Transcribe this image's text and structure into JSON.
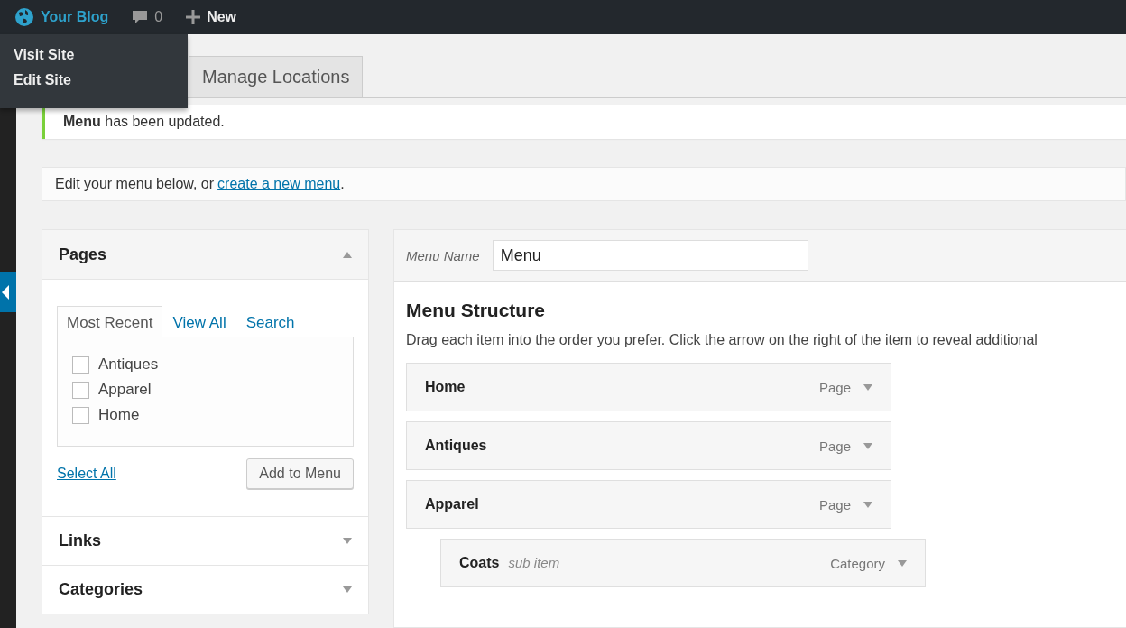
{
  "admin_bar": {
    "site": {
      "label": "Your Blog",
      "hovered": true
    },
    "comments": "0",
    "new": "New"
  },
  "site_menu": {
    "items": [
      "Visit Site",
      "Edit Site"
    ]
  },
  "tabs": [
    {
      "label": "Manage Locations",
      "selected": false
    }
  ],
  "notice": {
    "text": "**Menu** has been updated."
  },
  "edit_bar": {
    "text": "Edit your menu below, or",
    "link": "create a new menu",
    "after": "."
  },
  "sections": [
    {
      "title": "Pages",
      "expanded": true,
      "tabs": [
        {
          "label": "Most Recent",
          "selected": true
        },
        {
          "label": "View All",
          "selected": false
        },
        {
          "label": "Search",
          "selected": false
        }
      ],
      "items": [
        {
          "label": "Antiques",
          "checked": false
        },
        {
          "label": "Apparel",
          "checked": false
        },
        {
          "label": "Home",
          "checked": false
        }
      ],
      "select_all": "Select All",
      "add_button": "Add to Menu"
    },
    {
      "title": "Links",
      "expanded": false
    },
    {
      "title": "Categories",
      "expanded": false
    }
  ],
  "menu": {
    "name_label": "Menu Name",
    "name_value": "Menu",
    "heading": "Menu Structure",
    "description": "Drag each item into the order you prefer. Click the arrow on the right of the item to reveal additional",
    "items": [
      {
        "title": "Home",
        "type": "Page"
      },
      {
        "title": "Antiques",
        "type": "Page"
      },
      {
        "title": "Apparel",
        "type": "Page",
        "children": [
          {
            "title": "Coats",
            "note": "sub item",
            "type": "Category"
          }
        ]
      }
    ]
  }
}
